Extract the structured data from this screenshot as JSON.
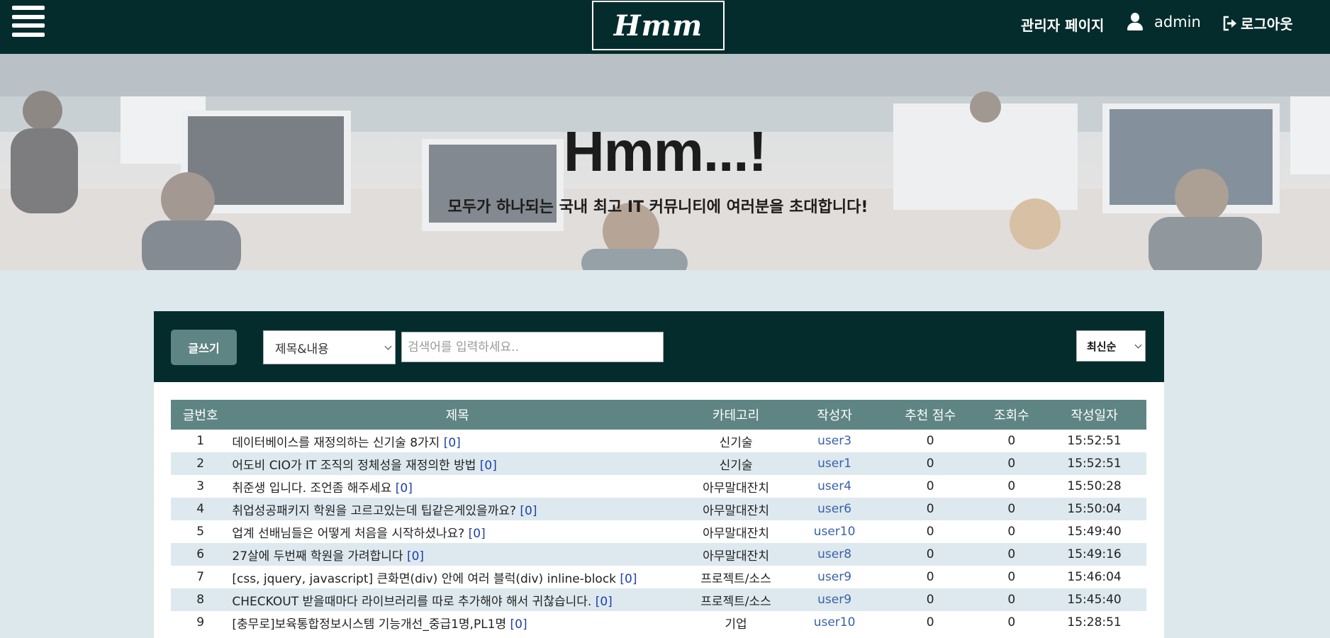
{
  "header": {
    "logo": "Hmm",
    "admin_page": "관리자 페이지",
    "username": "admin",
    "logout": "로그아웃",
    "icons": [
      "menu-icon",
      "user-icon",
      "sign-out-icon"
    ]
  },
  "hero": {
    "title": "Hmm...!",
    "subtitle": "모두가 하나되는 국내 최고 IT 커뮤니티에 여러분을 초대합니다!"
  },
  "toolbar": {
    "write_label": "글쓰기",
    "search_type_selected": "제목&내용",
    "search_placeholder": "검색어를 입력하세요..",
    "sort_selected": "최신순"
  },
  "table": {
    "columns": [
      "글번호",
      "제목",
      "카테고리",
      "작성자",
      "추천 점수",
      "조회수",
      "작성일자"
    ],
    "rows": [
      {
        "no": "1",
        "title": "데이터베이스를 재정의하는 신기술 8가지",
        "comments": "[0]",
        "category": "신기술",
        "author": "user3",
        "score": "0",
        "views": "0",
        "date": "15:52:51"
      },
      {
        "no": "2",
        "title": "어도비 CIO가 IT 조직의 정체성을 재정의한 방법",
        "comments": "[0]",
        "category": "신기술",
        "author": "user1",
        "score": "0",
        "views": "0",
        "date": "15:52:51"
      },
      {
        "no": "3",
        "title": "취준생 입니다. 조언좀 해주세요",
        "comments": "[0]",
        "category": "아무말대잔치",
        "author": "user4",
        "score": "0",
        "views": "0",
        "date": "15:50:28"
      },
      {
        "no": "4",
        "title": "취업성공패키지 학원을 고르고있는데 팁같은게있을까요?",
        "comments": "[0]",
        "category": "아무말대잔치",
        "author": "user6",
        "score": "0",
        "views": "0",
        "date": "15:50:04"
      },
      {
        "no": "5",
        "title": "업계 선배님들은 어떻게 처음을 시작하셨나요?",
        "comments": "[0]",
        "category": "아무말대잔치",
        "author": "user10",
        "score": "0",
        "views": "0",
        "date": "15:49:40"
      },
      {
        "no": "6",
        "title": "27살에 두번째 학원을 가려합니다",
        "comments": "[0]",
        "category": "아무말대잔치",
        "author": "user8",
        "score": "0",
        "views": "0",
        "date": "15:49:16"
      },
      {
        "no": "7",
        "title": "[css, jquery, javascript] 큰화면(div) 안에 여러 블럭(div) inline-block",
        "comments": "[0]",
        "category": "프로젝트/소스",
        "author": "user9",
        "score": "0",
        "views": "0",
        "date": "15:46:04"
      },
      {
        "no": "8",
        "title": "CHECKOUT 받을때마다 라이브러리를 따로 추가해야 해서 귀찮습니다.",
        "comments": "[0]",
        "category": "프로젝트/소스",
        "author": "user9",
        "score": "0",
        "views": "0",
        "date": "15:45:40"
      },
      {
        "no": "9",
        "title": "[충무로]보육통합정보시스템 기능개선_중급1명,PL1명",
        "comments": "[0]",
        "category": "기업",
        "author": "user10",
        "score": "0",
        "views": "0",
        "date": "15:28:51"
      }
    ]
  }
}
